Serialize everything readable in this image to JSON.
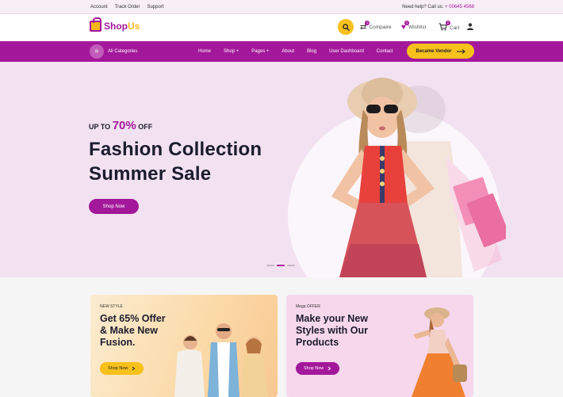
{
  "topbar": {
    "links": [
      "Account",
      "Track Order",
      "Support"
    ],
    "help_label": "Need help? Call us:",
    "phone": "+ 00645 4568"
  },
  "header": {
    "logo_shop": "Shop",
    "logo_us": "Us",
    "compare_label": "Compaire",
    "compare_count": "3",
    "wishlist_label": "Wishlist",
    "wishlist_count": "3",
    "cart_label": "Cart",
    "cart_count": "2"
  },
  "nav": {
    "all_categories": "All Categories",
    "links": [
      "Home",
      "Shop +",
      "Pages +",
      "About",
      "Blog",
      "User Dashboard",
      "Contact"
    ],
    "vendor_button": "Became Vendor"
  },
  "hero": {
    "tag_prefix": "UP TO",
    "tag_percent": "70%",
    "tag_suffix": "OFF",
    "title_line1": "Fashion Collection",
    "title_line2": "Summer Sale",
    "button": "Shop Now",
    "slides": 3,
    "active_slide": 2
  },
  "promos": [
    {
      "eyebrow": "NEW STYLE",
      "heading_lines": [
        "Get 65% Offer",
        "& Make New",
        "Fusion."
      ],
      "button": "Shop Now"
    },
    {
      "eyebrow": "Mega OFFER",
      "heading_lines": [
        "Make your New",
        "Styles with Our",
        "Products"
      ],
      "button": "Shop Now"
    }
  ],
  "colors": {
    "brand": "#a3189a",
    "accent": "#f7c11b",
    "hero_bg": "#f2e2f1"
  }
}
